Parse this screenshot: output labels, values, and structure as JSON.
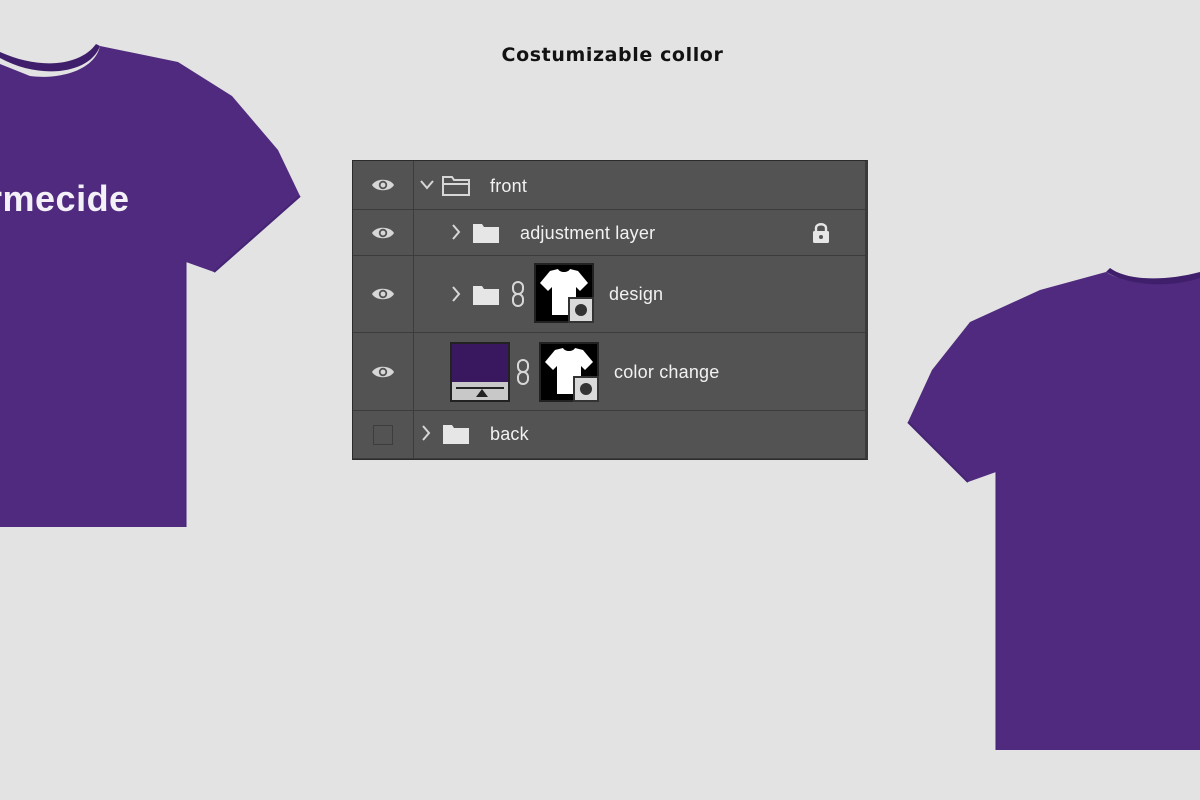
{
  "page": {
    "title": "Costumizable collor",
    "shirt_print_text": "rmecide",
    "shirt_color": "#4f2a7f"
  },
  "layers_panel": {
    "layers": [
      {
        "name": "front",
        "visible": true,
        "expanded": true,
        "type": "group"
      },
      {
        "name": "adjustment layer",
        "visible": true,
        "expanded": false,
        "type": "group",
        "locked": true
      },
      {
        "name": "design",
        "visible": true,
        "expanded": false,
        "type": "group",
        "has_mask": true
      },
      {
        "name": "color change",
        "visible": true,
        "type": "fill-layer",
        "fill_color": "#3a1860",
        "has_mask": true
      },
      {
        "name": "back",
        "visible": false,
        "expanded": false,
        "type": "group"
      }
    ],
    "icons": {
      "visibility": "eye-icon",
      "folder": "folder-icon",
      "expand": "chevron-right-icon",
      "collapse": "chevron-down-icon",
      "lock": "lock-icon",
      "link": "chain-link-icon"
    }
  }
}
